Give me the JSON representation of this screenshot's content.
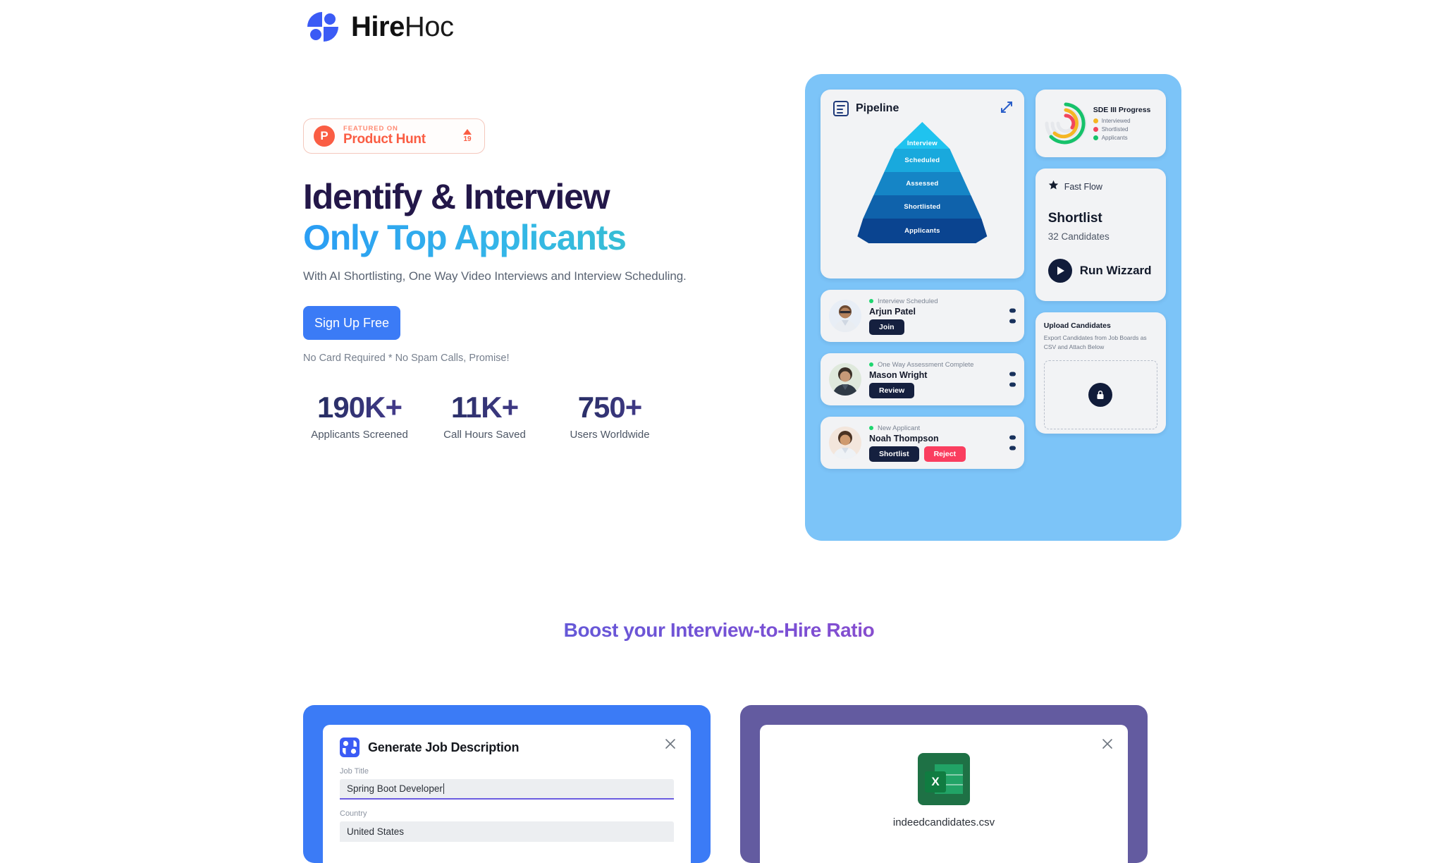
{
  "brand": {
    "name_bold": "Hire",
    "name_light": "Hoc",
    "logo_icon": "hirehoc-logo-icon",
    "accent_blue": "#3b5bf5"
  },
  "hero": {
    "badge": {
      "logo_letter": "P",
      "featured_label": "FEATURED ON",
      "product_name": "Product Hunt",
      "upvote_count": "19",
      "accent": "#fa5d43"
    },
    "headline_line1": "Identify & Interview",
    "headline_line2": "Only Top Applicants",
    "subheadline": "With AI Shortlisting, One Way Video Interviews and Interview Scheduling.",
    "cta_label": "Sign Up Free",
    "cta_note": "No Card Required * No Spam Calls, Promise!",
    "stats": [
      {
        "value": "190K+",
        "label": "Applicants Screened"
      },
      {
        "value": "11K+",
        "label": "Call Hours Saved"
      },
      {
        "value": "750+",
        "label": "Users Worldwide"
      }
    ]
  },
  "dashboard": {
    "background_color": "#7cc4f8",
    "pipeline": {
      "title": "Pipeline",
      "doc_icon": "document-icon",
      "expand_icon": "expand-arrows-icon",
      "stages": [
        {
          "label": "Interview",
          "color": "#1fc3ef"
        },
        {
          "label": "Scheduled",
          "color": "#19a9dd"
        },
        {
          "label": "Assessed",
          "color": "#1585c6"
        },
        {
          "label": "Shortlisted",
          "color": "#0f62ab"
        },
        {
          "label": "Applicants",
          "color": "#0a4490"
        }
      ]
    },
    "progress": {
      "title": "SDE III Progress",
      "legend": [
        {
          "label": "Interviewed",
          "color": "#f5b623"
        },
        {
          "label": "Shortlisted",
          "color": "#f2465d"
        },
        {
          "label": "Applicants",
          "color": "#16c26a"
        }
      ]
    },
    "fastflow": {
      "star_icon": "star-icon",
      "header_label": "Fast Flow",
      "title": "Shortlist",
      "subtitle": "32 Candidates",
      "run_label": "Run Wizzard",
      "play_icon": "play-icon"
    },
    "candidates": [
      {
        "status": "Interview Scheduled",
        "name": "Arjun Patel",
        "actions": [
          {
            "label": "Join",
            "style": "dark"
          }
        ]
      },
      {
        "status": "One Way Assessment Complete",
        "name": "Mason Wright",
        "actions": [
          {
            "label": "Review",
            "style": "dark"
          }
        ]
      },
      {
        "status": "New Applicant",
        "name": "Noah Thompson",
        "actions": [
          {
            "label": "Shortlist",
            "style": "dark"
          },
          {
            "label": "Reject",
            "style": "red"
          }
        ]
      }
    ],
    "upload": {
      "title": "Upload Candidates",
      "subtitle": "Export Candidates from Job Boards as CSV and Attach Below",
      "icon": "upload-lock-icon"
    }
  },
  "section2": {
    "title": "Boost your Interview-to-Hire Ratio",
    "cards": [
      {
        "frame_color": "#3b7bf6",
        "modal_title": "Generate Job Description",
        "logo_icon": "hirehoc-logo-icon",
        "close_icon": "close-icon",
        "fields": [
          {
            "label": "Job Title",
            "value": "Spring Boot Developer",
            "focused": true
          },
          {
            "label": "Country",
            "value": "United States",
            "focused": false
          }
        ]
      },
      {
        "frame_color": "#635ba0",
        "close_icon": "close-icon",
        "file_icon": "excel-csv-icon",
        "file_icon_letter": "X",
        "file_name": "indeedcandidates.csv"
      }
    ]
  }
}
